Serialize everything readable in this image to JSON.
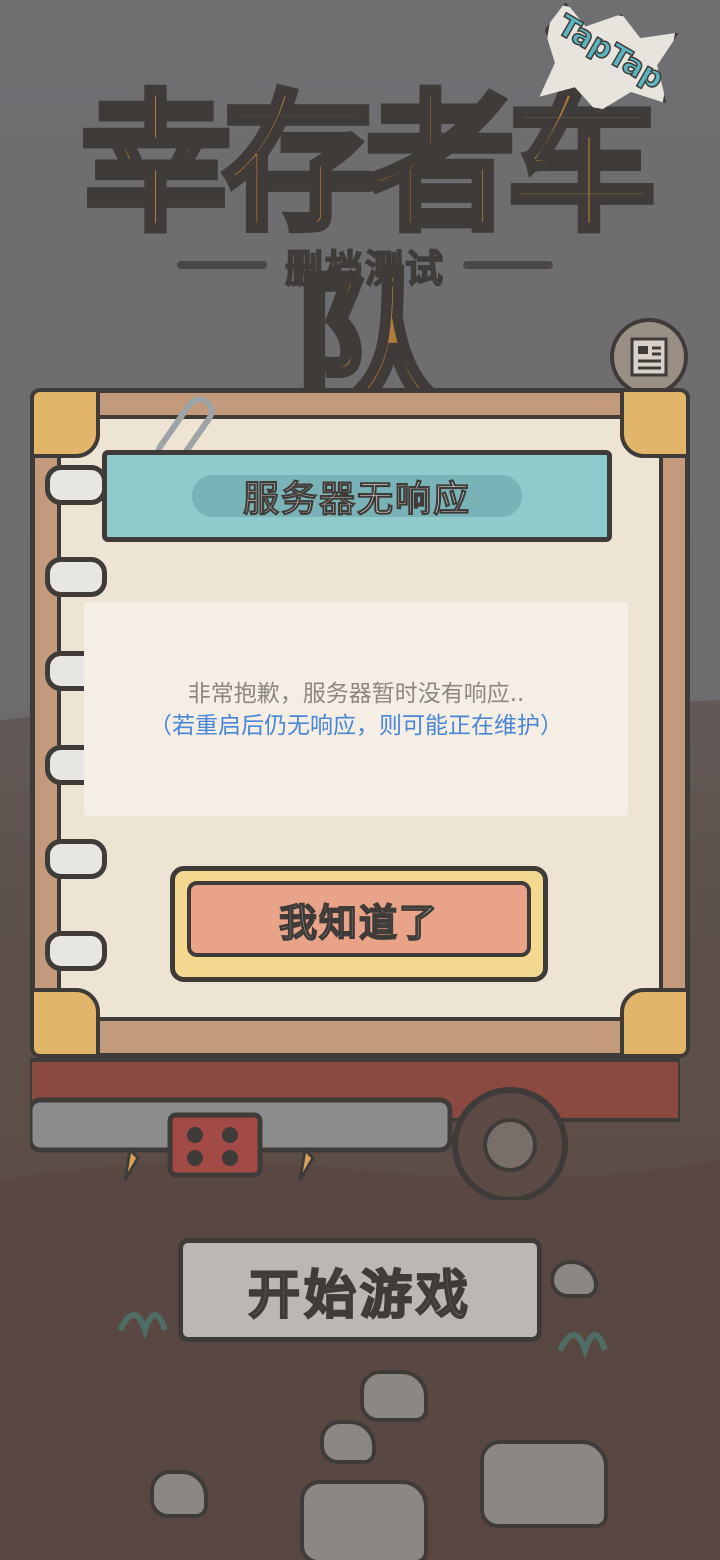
{
  "game": {
    "logo_title": "幸存者车队",
    "badge_text": "TapTap",
    "logo_subtitle": "删档测试"
  },
  "dialog": {
    "title": "服务器无响应",
    "message_line1": "非常抱歉，服务器暂时没有响应..",
    "message_line2": "（若重启后仍无响应，则可能正在维护）",
    "confirm_label": "我知道了"
  },
  "main_menu": {
    "start_label": "开始游戏"
  },
  "colors": {
    "banner": "#8fcacc",
    "confirm_button": "#e9a388",
    "message_note": "#4a86d6",
    "paper": "#ede4d3"
  },
  "icons": {
    "news": "news-icon"
  }
}
